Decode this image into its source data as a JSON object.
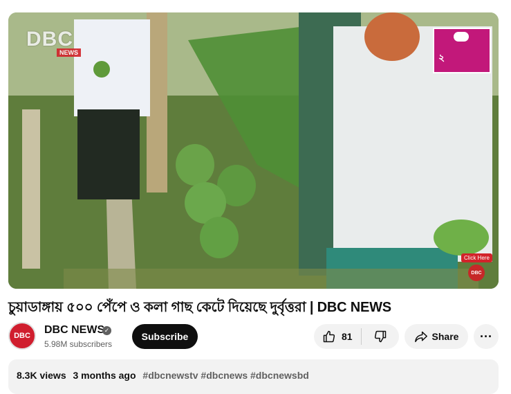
{
  "video": {
    "logo_text": "DBC",
    "logo_sub": "NEWS",
    "promo_text": "২",
    "click_here": "Click Here",
    "badge_text": "DBC"
  },
  "title": "চুয়াডাঙ্গায় ৫০০ পেঁপে ও কলা গাছ কেটে দিয়েছে দুর্বৃত্তরা | DBC NEWS",
  "channel": {
    "avatar_text": "DBC",
    "name": "DBC NEWS",
    "verified_glyph": "✓",
    "subscribers": "5.98M subscribers"
  },
  "actions": {
    "subscribe": "Subscribe",
    "likes": "81",
    "share": "Share",
    "more": "···"
  },
  "description": {
    "views": "8.3K views",
    "age": "3 months ago",
    "tags": "#dbcnewstv #dbcnews #dbcnewsbd"
  }
}
